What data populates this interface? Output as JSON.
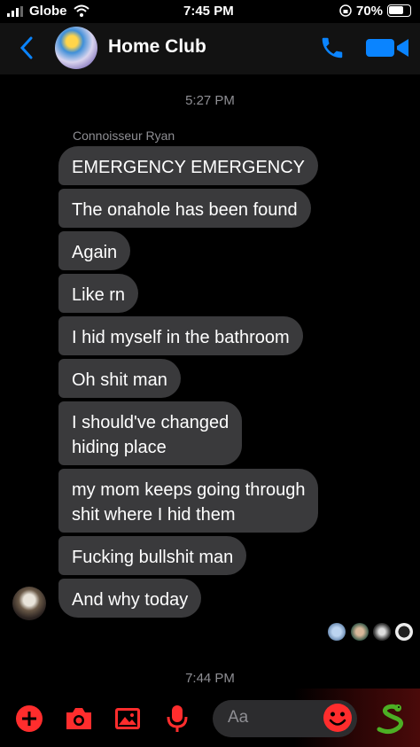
{
  "status_bar": {
    "carrier": "Globe",
    "time": "7:45 PM",
    "battery": "70%",
    "icons": [
      "signal-icon",
      "wifi-icon",
      "orientation-lock-icon",
      "battery-icon"
    ]
  },
  "header": {
    "title": "Home Club",
    "icons": [
      "back-chevron-icon",
      "group-avatar",
      "phone-icon",
      "video-icon"
    ],
    "accent": "#0a84ff"
  },
  "conversation": {
    "timestamp_top": "5:27 PM",
    "sender_name": "Connoisseur Ryan",
    "messages": [
      {
        "text": "EMERGENCY EMERGENCY"
      },
      {
        "text": "The onahole has been found"
      },
      {
        "text": "Again"
      },
      {
        "text": "Like rn"
      },
      {
        "text": "I hid myself in the bathroom"
      },
      {
        "text": "Oh shit man"
      },
      {
        "text": "I should've changed",
        "text2": "hiding place"
      },
      {
        "text": "my mom keeps going through",
        "text2": "shit where I hid them"
      },
      {
        "text": "Fucking bullshit man"
      },
      {
        "text": "And why today"
      }
    ],
    "timestamp_bottom": "7:44 PM",
    "read_receipts": [
      "read-avatar-1",
      "read-avatar-2",
      "read-avatar-3",
      "read-avatar-4"
    ]
  },
  "composer": {
    "placeholder": "Aa",
    "accent": "#ff2d2d",
    "icons": [
      "plus-icon",
      "camera-icon",
      "image-icon",
      "microphone-icon",
      "emoji-icon",
      "snake-sticker-icon"
    ]
  }
}
